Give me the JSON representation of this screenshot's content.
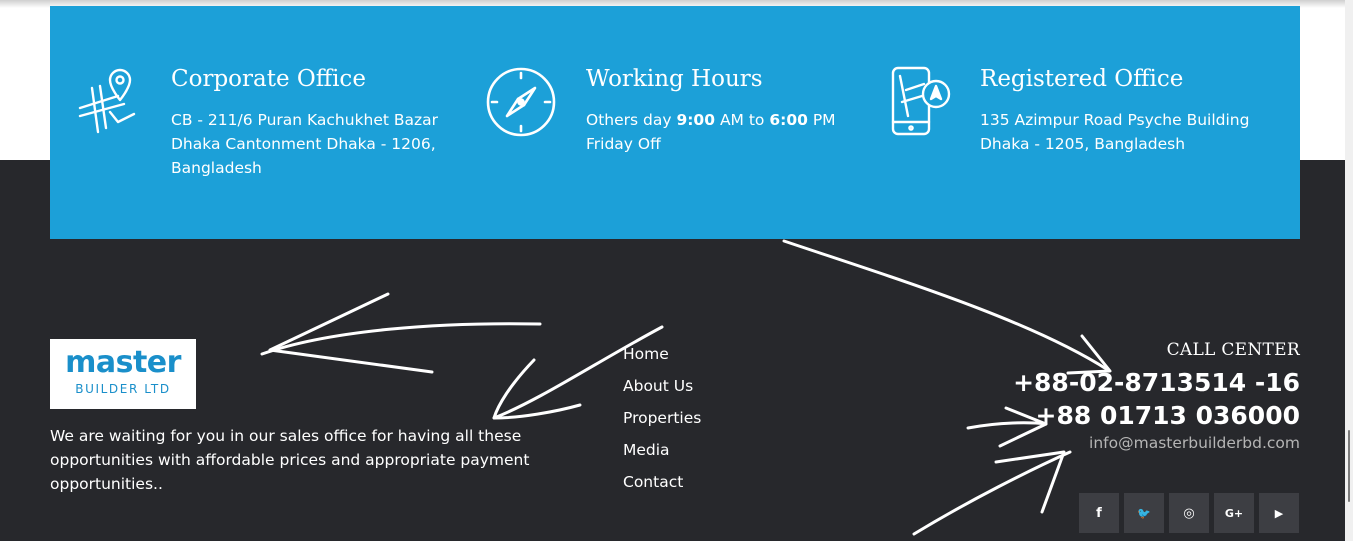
{
  "banner": {
    "corporate": {
      "icon": "map-location-icon",
      "title": "Corporate Office",
      "lines": [
        "CB - 211/6 Puran Kachukhet Bazar",
        "Dhaka Cantonment Dhaka - 1206,",
        "Bangladesh"
      ]
    },
    "hours": {
      "icon": "compass-icon",
      "title": "Working Hours",
      "line1_prefix": "Others day ",
      "open_time": "9:00",
      "line1_mid": " AM to ",
      "close_time": "6:00",
      "line1_suffix": " PM",
      "line2": "Friday Off"
    },
    "registered": {
      "icon": "phone-map-icon",
      "title": "Registered Office",
      "lines": [
        "135 Azimpur Road Psyche Building",
        "Dhaka - 1205, Bangladesh"
      ]
    }
  },
  "footer": {
    "logo": {
      "main": "master",
      "sub": "BUILDER LTD"
    },
    "about": "We are waiting for you in our sales office for having all these opportunities with affordable prices and appropriate payment opportunities..",
    "menu": [
      "Home",
      "About Us",
      "Properties",
      "Media",
      "Contact"
    ],
    "contact": {
      "label": "CALL CENTER",
      "phone1": "+88-02-8713514 -16",
      "phone2": "+88 01713 036000",
      "email": "info@masterbuilderbd.com"
    },
    "social": [
      {
        "icon": "facebook-icon",
        "glyph": "f"
      },
      {
        "icon": "twitter-icon",
        "glyph": "🐦"
      },
      {
        "icon": "instagram-icon",
        "glyph": "◎"
      },
      {
        "icon": "google-plus-icon",
        "glyph": "G+"
      },
      {
        "icon": "youtube-icon",
        "glyph": "▶"
      }
    ]
  },
  "colors": {
    "banner_bg": "#1ca0d8",
    "footer_bg": "#27282c",
    "logo_blue": "#1a8fca",
    "social_bg": "#3d3e43"
  }
}
